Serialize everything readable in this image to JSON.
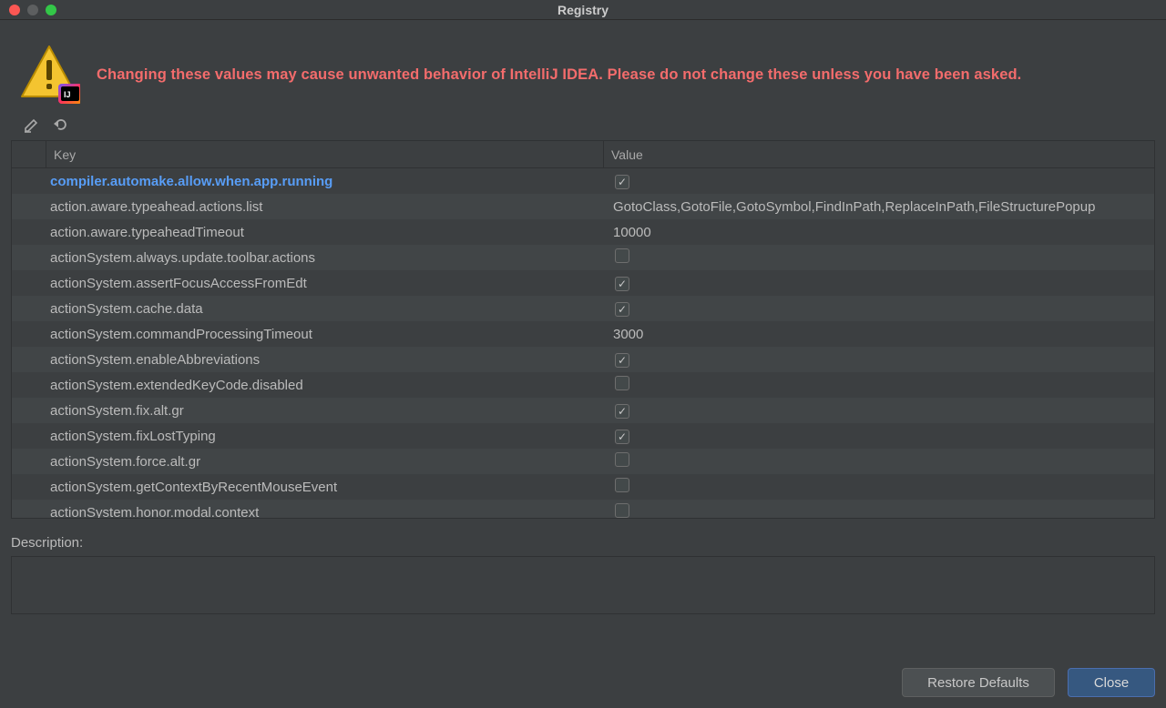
{
  "title": "Registry",
  "warning_text": "Changing these values may cause unwanted behavior of IntelliJ IDEA. Please do not change these unless you have been asked.",
  "columns": {
    "key": "Key",
    "value": "Value"
  },
  "rows": [
    {
      "key": "compiler.automake.allow.when.app.running",
      "value_type": "checkbox",
      "value": true,
      "modified": true
    },
    {
      "key": "action.aware.typeahead.actions.list",
      "value_type": "text",
      "value": "GotoClass,GotoFile,GotoSymbol,FindInPath,ReplaceInPath,FileStructurePopup",
      "modified": false
    },
    {
      "key": "action.aware.typeaheadTimeout",
      "value_type": "text",
      "value": "10000",
      "modified": false
    },
    {
      "key": "actionSystem.always.update.toolbar.actions",
      "value_type": "checkbox",
      "value": false,
      "modified": false
    },
    {
      "key": "actionSystem.assertFocusAccessFromEdt",
      "value_type": "checkbox",
      "value": true,
      "modified": false
    },
    {
      "key": "actionSystem.cache.data",
      "value_type": "checkbox",
      "value": true,
      "modified": false
    },
    {
      "key": "actionSystem.commandProcessingTimeout",
      "value_type": "text",
      "value": "3000",
      "modified": false
    },
    {
      "key": "actionSystem.enableAbbreviations",
      "value_type": "checkbox",
      "value": true,
      "modified": false
    },
    {
      "key": "actionSystem.extendedKeyCode.disabled",
      "value_type": "checkbox",
      "value": false,
      "modified": false
    },
    {
      "key": "actionSystem.fix.alt.gr",
      "value_type": "checkbox",
      "value": true,
      "modified": false
    },
    {
      "key": "actionSystem.fixLostTyping",
      "value_type": "checkbox",
      "value": true,
      "modified": false
    },
    {
      "key": "actionSystem.force.alt.gr",
      "value_type": "checkbox",
      "value": false,
      "modified": false
    },
    {
      "key": "actionSystem.getContextByRecentMouseEvent",
      "value_type": "checkbox",
      "value": false,
      "modified": false
    },
    {
      "key": "actionSystem.honor.modal.context",
      "value_type": "checkbox",
      "value": false,
      "modified": false
    }
  ],
  "description_label": "Description:",
  "description_text": "",
  "buttons": {
    "restore": "Restore Defaults",
    "close": "Close"
  }
}
